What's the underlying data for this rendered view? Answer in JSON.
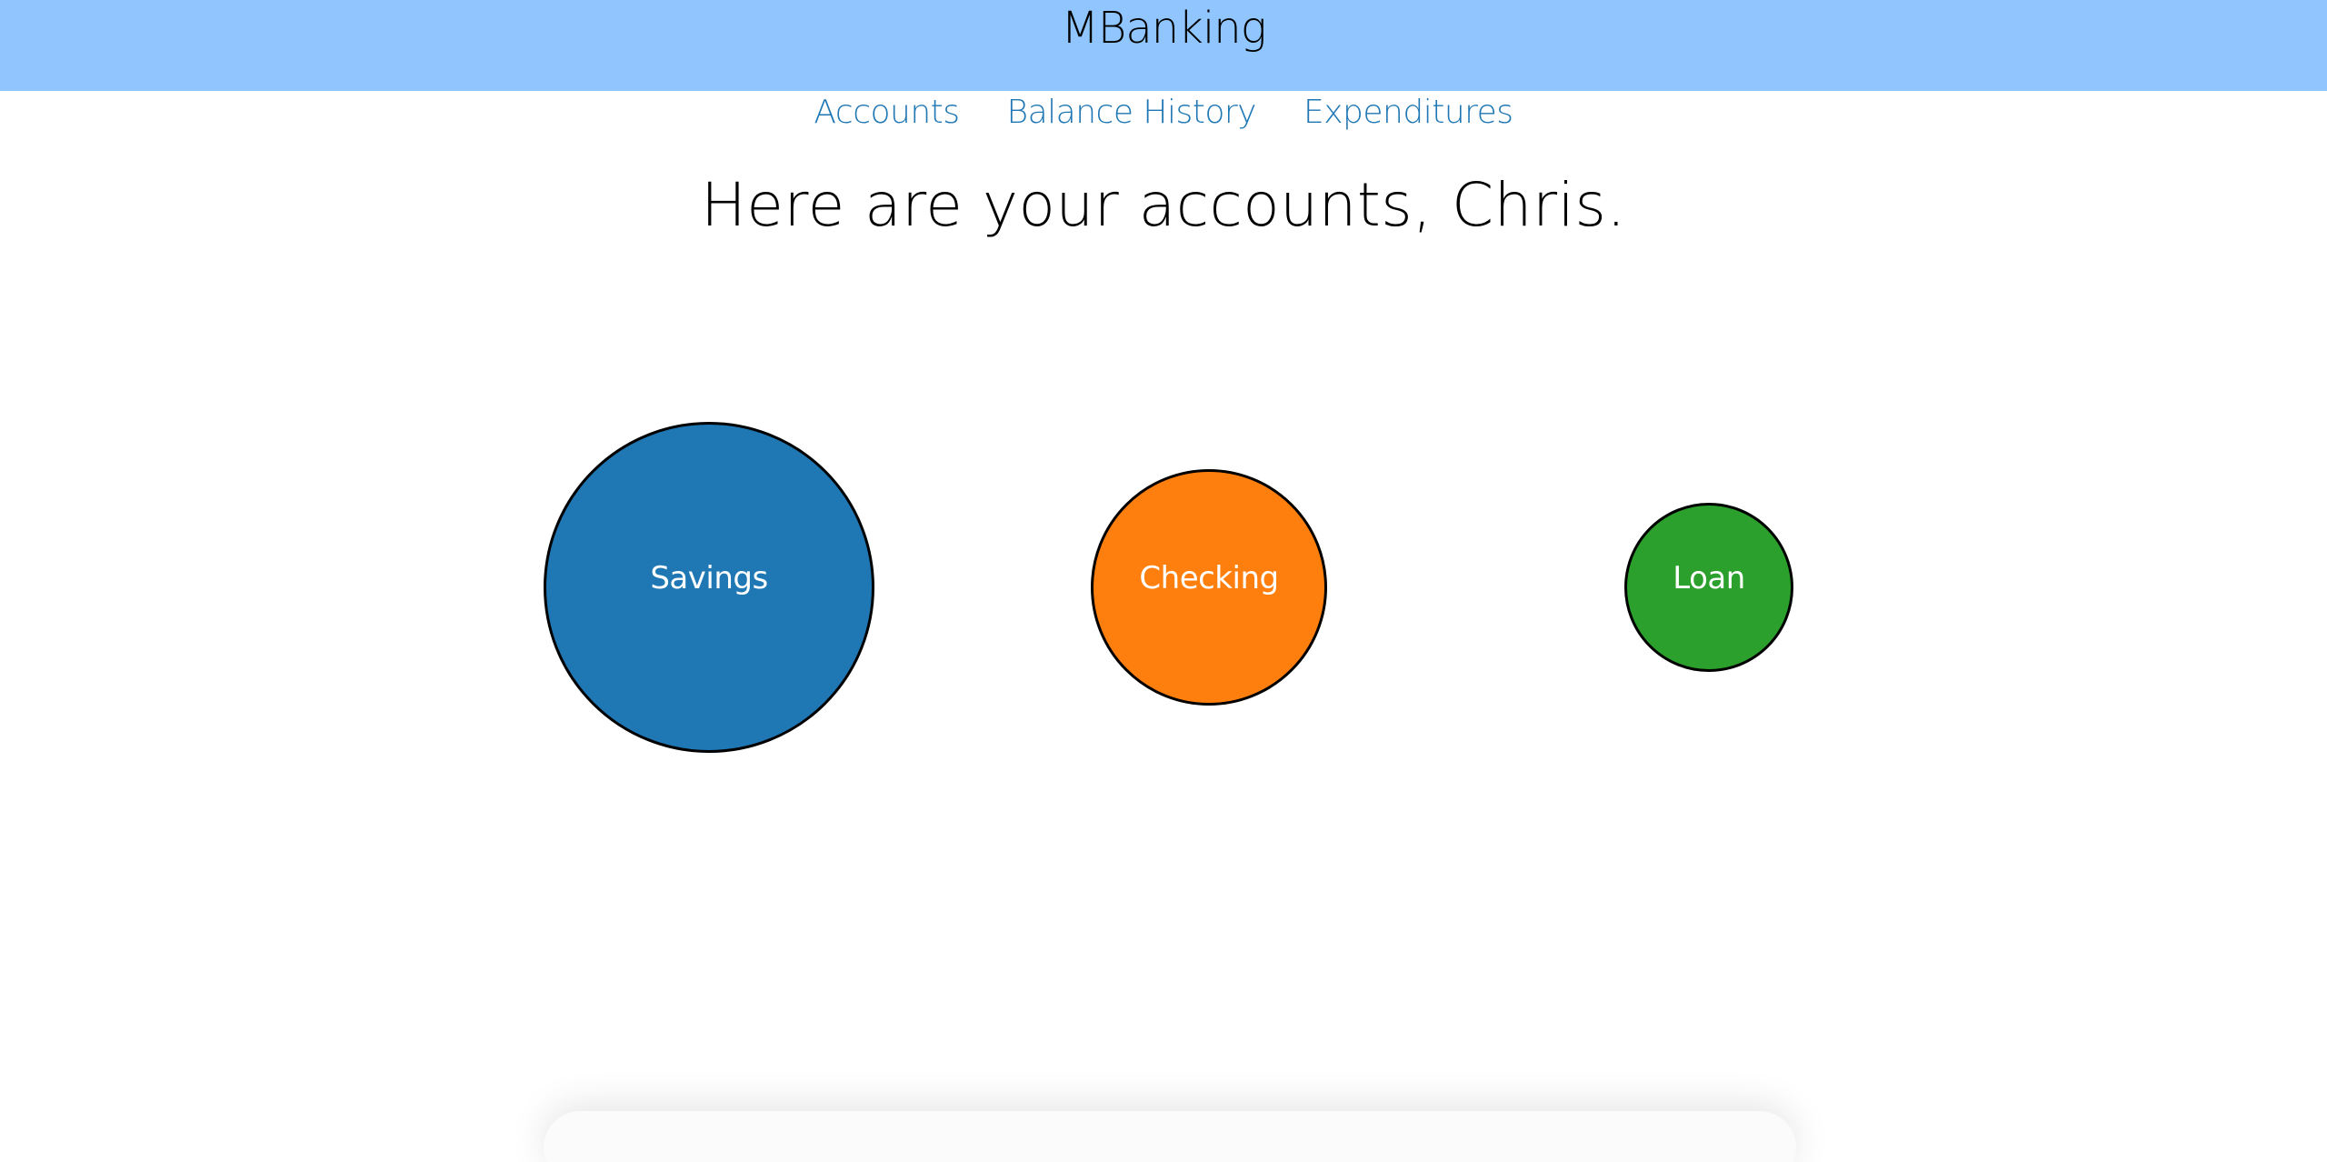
{
  "header": {
    "title": "MBanking",
    "background_color": "#90c6fd"
  },
  "nav": {
    "items": [
      {
        "label": "Accounts"
      },
      {
        "label": "Balance History"
      },
      {
        "label": "Expenditures"
      }
    ],
    "link_color": "#1f77b4"
  },
  "main": {
    "greeting": "Here are your accounts, Chris."
  },
  "accounts": [
    {
      "label": "Savings",
      "color": "#1f77b4"
    },
    {
      "label": "Checking",
      "color": "#ff7f0e"
    },
    {
      "label": "Loan",
      "color": "#2ca02c"
    }
  ]
}
